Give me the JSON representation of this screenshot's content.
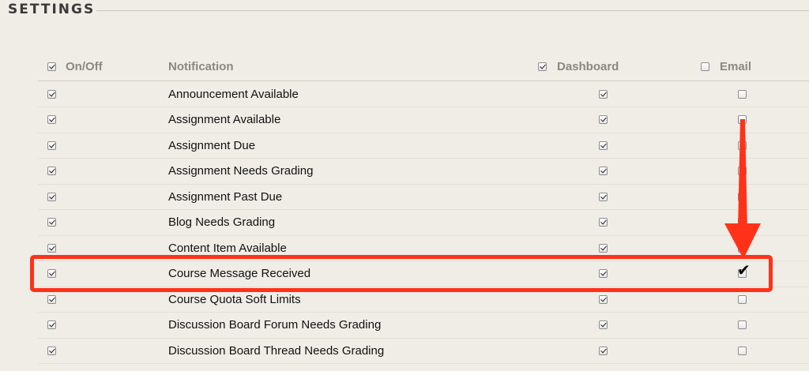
{
  "section": {
    "title": "SETTINGS"
  },
  "header": {
    "onoff_label": "On/Off",
    "notification_label": "Notification",
    "dashboard_label": "Dashboard",
    "email_label": "Email",
    "onoff_checked": true,
    "dashboard_checked": true,
    "email_checked": false
  },
  "rows": [
    {
      "label": "Announcement Available",
      "on": true,
      "dashboard": true,
      "email": false
    },
    {
      "label": "Assignment Available",
      "on": true,
      "dashboard": true,
      "email": false
    },
    {
      "label": "Assignment Due",
      "on": true,
      "dashboard": true,
      "email": false
    },
    {
      "label": "Assignment Needs Grading",
      "on": true,
      "dashboard": true,
      "email": false
    },
    {
      "label": "Assignment Past Due",
      "on": true,
      "dashboard": true,
      "email": false
    },
    {
      "label": "Blog Needs Grading",
      "on": true,
      "dashboard": true,
      "email": false
    },
    {
      "label": "Content Item Available",
      "on": true,
      "dashboard": true,
      "email": false
    },
    {
      "label": "Course Message Received",
      "on": true,
      "dashboard": true,
      "email": true,
      "highlighted": true
    },
    {
      "label": "Course Quota Soft Limits",
      "on": true,
      "dashboard": true,
      "email": false
    },
    {
      "label": "Discussion Board Forum Needs Grading",
      "on": true,
      "dashboard": true,
      "email": false
    },
    {
      "label": "Discussion Board Thread Needs Grading",
      "on": true,
      "dashboard": true,
      "email": false
    }
  ],
  "annotation": {
    "highlight_color": "#ff3219",
    "arrow_color": "#ff3219"
  }
}
